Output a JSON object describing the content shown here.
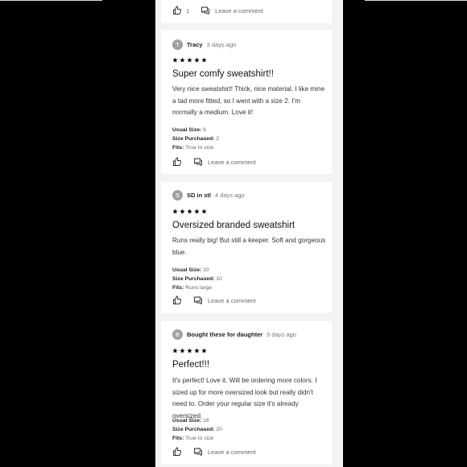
{
  "common": {
    "comment_label": "Leave a comment"
  },
  "top_card": {
    "like_count": "1"
  },
  "reviews": [
    {
      "avatar": "T",
      "author": "Tracy",
      "date": "3 days ago",
      "rating": 5,
      "title": "Super comfy sweatshirt!!",
      "body": "Very nice sweatshirt! Thick, nice material. I like mine a tad more fitted, so I went with a size 2. I'm normally a medium. Love it!",
      "usual_size_label": "Usual Size:",
      "usual_size": "6",
      "size_purchased_label": "Size Purchased:",
      "size_purchased": "2",
      "fits_label": "Fits:",
      "fits": "True to size"
    },
    {
      "avatar": "S",
      "author": "SD in stl",
      "date": "4 days ago",
      "rating": 5,
      "title": "Oversized branded sweatshirt",
      "body": "Runs really big! But still a keeper. Soft and gorgeous blue.",
      "usual_size_label": "Usual Size:",
      "usual_size": "10",
      "size_purchased_label": "Size Purchased:",
      "size_purchased": "10",
      "fits_label": "Fits:",
      "fits": "Runs large"
    },
    {
      "avatar": "B",
      "author": "Bought these for daughter",
      "date": "5 days ago",
      "rating": 5,
      "title": "Perfect!!!",
      "body": "It's perfect! Love it. Will be ordering more colors. I sized up for more oversized look but really didn't need to. Order your regular size it's already oversized.",
      "usual_size_label": "Usual Size:",
      "usual_size": "16",
      "size_purchased_label": "Size Purchased:",
      "size_purchased": "20",
      "fits_label": "Fits:",
      "fits": "True to size"
    }
  ],
  "icons": {
    "like": "thumbs-up-icon",
    "comment": "comment-bubble-icon",
    "star": "star-icon"
  },
  "colors": {
    "background": "#000000",
    "column": "#f3f3f3",
    "card": "#ffffff",
    "avatar": "#a0a0a0"
  }
}
